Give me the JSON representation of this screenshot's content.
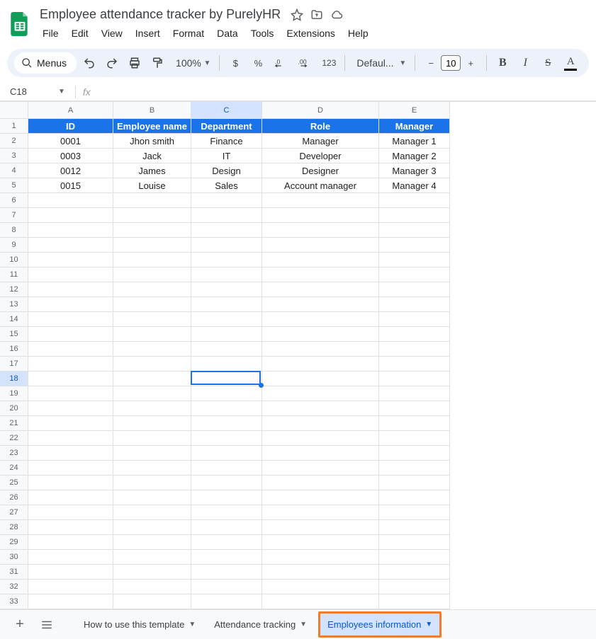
{
  "doc": {
    "title": "Employee attendance tracker by PurelyHR"
  },
  "menubar": [
    "File",
    "Edit",
    "View",
    "Insert",
    "Format",
    "Data",
    "Tools",
    "Extensions",
    "Help"
  ],
  "toolbar": {
    "menus": "Menus",
    "zoom": "100%",
    "currency": "$",
    "percent": "%",
    "dec_dec": ".0",
    "inc_dec": ".00",
    "fmt123": "123",
    "font": "Defaul...",
    "font_size": "10",
    "bold": "B",
    "italic": "I",
    "strike": "S",
    "textcolor": "A"
  },
  "namebox": {
    "ref": "C18",
    "fx": ""
  },
  "grid": {
    "cols": [
      "A",
      "B",
      "C",
      "D",
      "E"
    ],
    "rowcount": 33,
    "headers": [
      "ID",
      "Employee name",
      "Department",
      "Role",
      "Manager"
    ],
    "rows": [
      [
        "0001",
        "Jhon smith",
        "Finance",
        "Manager",
        "Manager 1"
      ],
      [
        "0003",
        "Jack",
        "IT",
        "Developer",
        "Manager 2"
      ],
      [
        "0012",
        "James",
        "Design",
        "Designer",
        "Manager 3"
      ],
      [
        "0015",
        "Louise",
        "Sales",
        "Account manager",
        "Manager 4"
      ]
    ],
    "selected": {
      "col": 2,
      "row": 18
    }
  },
  "tabs": {
    "list": [
      {
        "name": "How to use this template",
        "active": false
      },
      {
        "name": "Attendance tracking",
        "active": false
      },
      {
        "name": "Employees information",
        "active": true,
        "highlighted": true
      }
    ]
  }
}
